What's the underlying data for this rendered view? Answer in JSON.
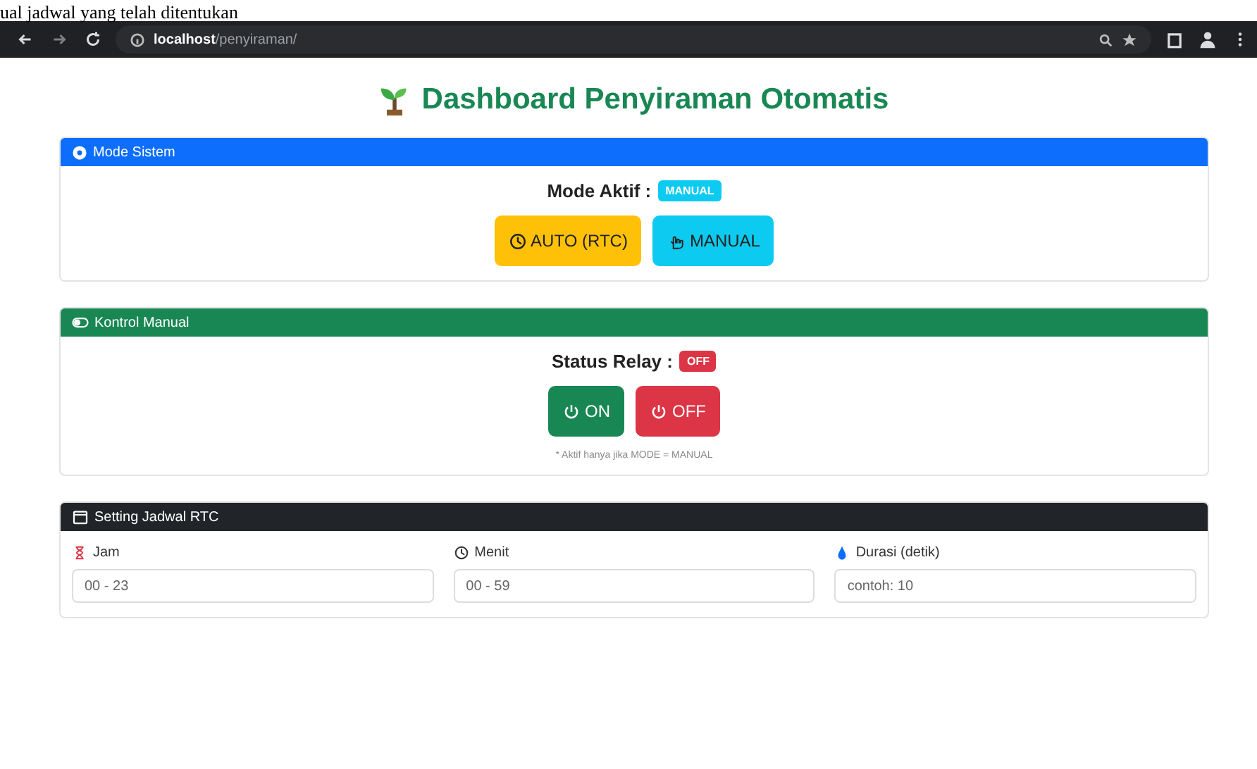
{
  "caption": "ual jadwal yang telah ditentukan",
  "browser": {
    "address_host": "localhost",
    "address_path": "/penyiraman/"
  },
  "page_title": "Dashboard Penyiraman Otomatis",
  "mode_card": {
    "title": "Mode Sistem",
    "label": "Mode Aktif :",
    "badge": {
      "text": "MANUAL",
      "kind": "info"
    },
    "buttons": [
      {
        "label": "AUTO (RTC)",
        "kind": "auto"
      },
      {
        "label": "MANUAL",
        "kind": "manual"
      }
    ]
  },
  "manual_card": {
    "title": "Kontrol Manual",
    "label": "Status Relay :",
    "relay": {
      "text": "OFF",
      "on": false
    },
    "buttons": [
      {
        "label": "ON",
        "kind": "on"
      },
      {
        "label": "OFF",
        "kind": "off"
      }
    ],
    "note": "* Aktif hanya jika MODE = MANUAL"
  },
  "schedule_card": {
    "title": "Setting Jadwal RTC",
    "fields": [
      {
        "label": "Jam",
        "kind": "hour",
        "placeholder": "00 - 23"
      },
      {
        "label": "Menit",
        "kind": "minute",
        "placeholder": "00 - 59"
      },
      {
        "label": "Durasi (detik)",
        "kind": "duration",
        "placeholder": "contoh: 10"
      }
    ]
  }
}
